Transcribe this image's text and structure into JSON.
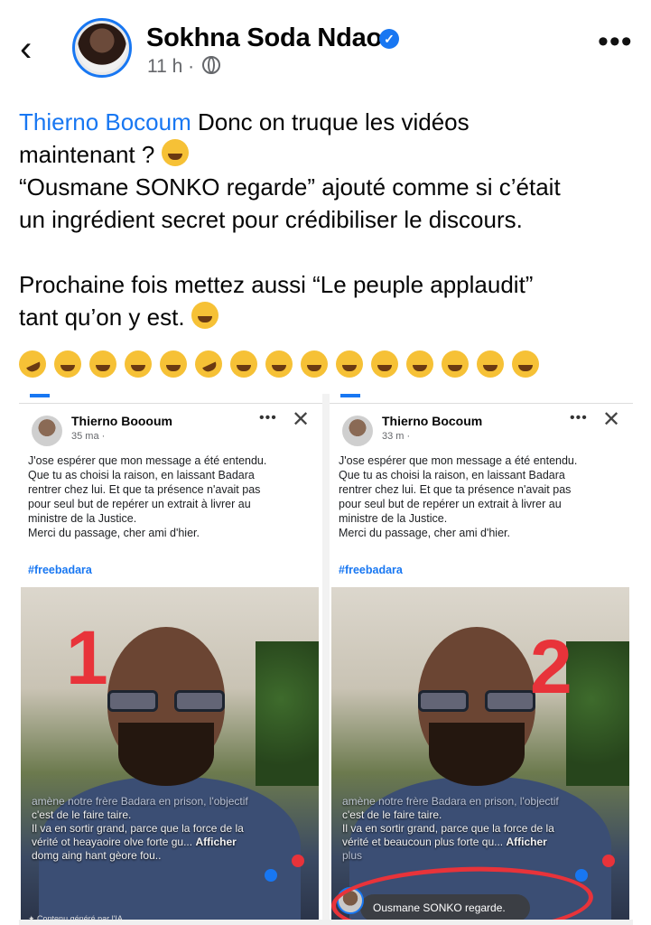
{
  "header": {
    "author_name": "Sokhna Soda Ndao",
    "time": "11 h ·",
    "more_label": "•••"
  },
  "post": {
    "mention": "Thierno Bocoum",
    "line1_rest": " Donc on truque les vidéos",
    "line2": "maintenant ? ",
    "line3": "“Ousmane SONKO regarde” ajouté comme si c’était",
    "line4": "un ingrédient secret pour crédibiliser le discours.",
    "line5": "Prochaine fois mettez aussi “Le peuple applaudit”",
    "line6": "tant qu’on y est. "
  },
  "emojis": [
    "rolling-laughing",
    "joy",
    "joy",
    "joy",
    "joy",
    "rolling-laughing",
    "joy",
    "joy",
    "joy",
    "joy",
    "joy",
    "joy",
    "joy",
    "joy",
    "joy"
  ],
  "screenshots": {
    "left": {
      "name": "Thierno Booou​m",
      "time": "35 ma ·",
      "more": "•••",
      "close": "✕",
      "text_lines": [
        "J'ose espérer que mon message a été entendu.",
        "Que tu as choisi la raison, en laissant Badara",
        "rentrer chez lui. Et que ta présence n'avait pas",
        "pour seul but de repérer un extrait à livrer au",
        "ministre de la Justice.",
        "Merci du passage, cher ami d'hier."
      ],
      "hashtag": "#freebadara",
      "number": "1",
      "overlay": {
        "l1": "amène notre frère Badara en prison, l'objectif",
        "l2": "c'est de le faire taire.",
        "l3": "Il va en sortir grand, parce que la force de la",
        "l4": "vérité ot heayaoire olve forte gu...",
        "afficher": "Afficher",
        "l5": "domg aing hant gèore fou.."
      },
      "ai_note": "✦ Contenu généré par l'IA"
    },
    "right": {
      "name": "Thierno Bocoum",
      "time": "33 m ·",
      "more": "•••",
      "close": "✕",
      "text_lines": [
        "J'ose espérer que mon message a été entendu.",
        "Que tu as choisi la raison, en laissant Badara",
        "rentrer chez lui. Et que ta présence n'avait pas",
        "pour seul but de repérer un extrait à livrer au",
        "ministre de la Justice.",
        "Merci du passage, cher ami d'hier."
      ],
      "hashtag": "#freebadara",
      "number": "2",
      "overlay": {
        "l1": "amène notre frère Badara en prison, l'objectif",
        "l2": "c'est de le faire taire.",
        "l3": "Il va en sortir grand, parce que la force de la",
        "l4": "vérité et beaucoun plus forte qu...",
        "afficher": "Afficher",
        "l5": "plus"
      },
      "sonko_label": "Ousmane SONKO regarde."
    }
  }
}
